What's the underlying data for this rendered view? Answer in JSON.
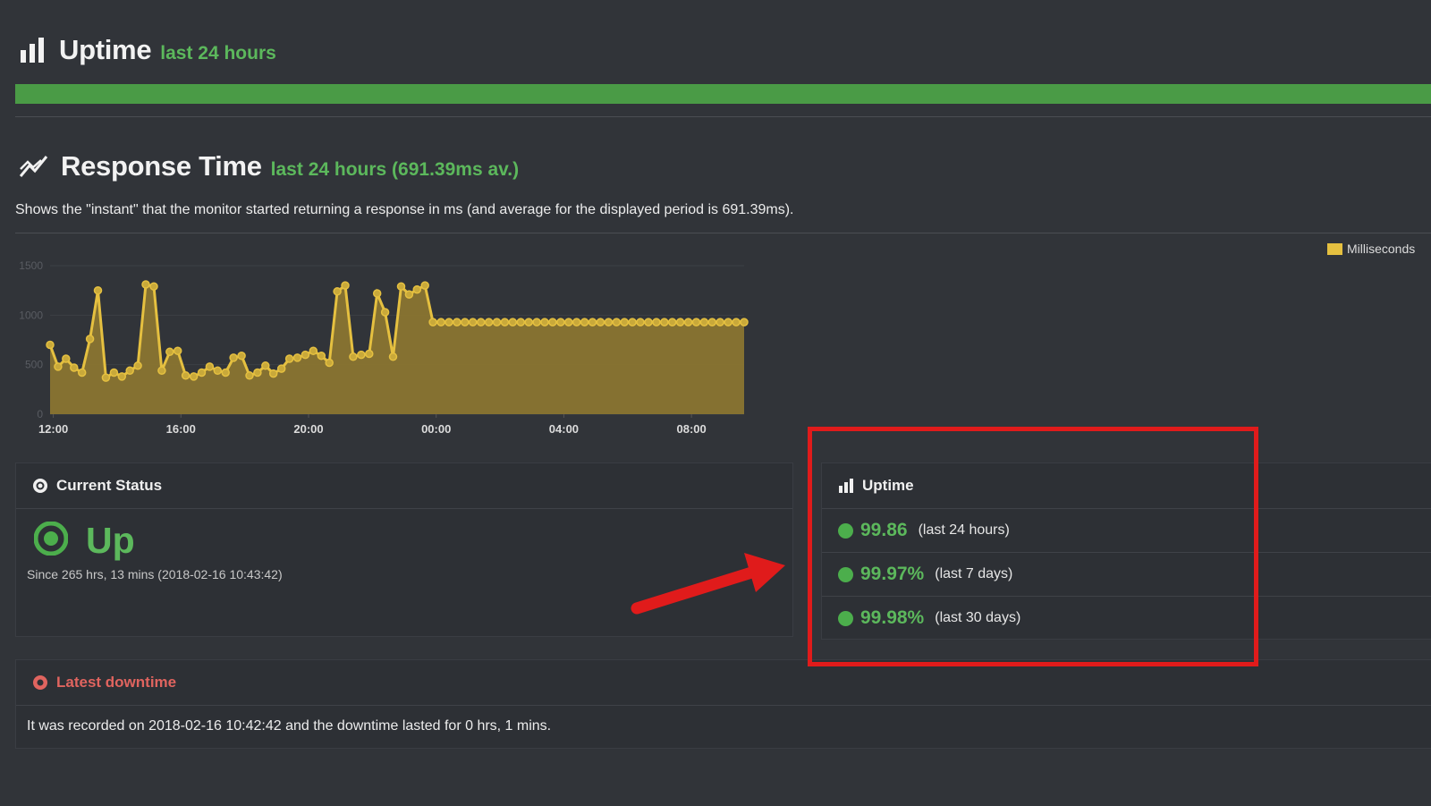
{
  "uptime_section": {
    "title": "Uptime",
    "subtitle": "last 24 hours",
    "bar_percent": 100,
    "icon": "bar-chart-icon"
  },
  "response_section": {
    "title": "Response Time",
    "subtitle": "last 24 hours (691.39ms av.)",
    "description": "Shows the \"instant\" that the monitor started returning a response in ms (and average for the displayed period is 691.39ms).",
    "icon": "line-chart-icon"
  },
  "chart_data": {
    "type": "area",
    "series": [
      {
        "name": "Milliseconds",
        "color": "#e5c040",
        "x": [
          11.9,
          12.15,
          12.4,
          12.65,
          12.9,
          13.15,
          13.4,
          13.65,
          13.9,
          14.15,
          14.4,
          14.65,
          14.9,
          15.15,
          15.4,
          15.65,
          15.9,
          16.15,
          16.4,
          16.65,
          16.9,
          17.15,
          17.4,
          17.65,
          17.9,
          18.15,
          18.4,
          18.65,
          18.9,
          19.15,
          19.4,
          19.65,
          19.9,
          20.15,
          20.4,
          20.65,
          20.9,
          21.15,
          21.4,
          21.65,
          21.9,
          22.15,
          22.4,
          22.65,
          22.9,
          23.15,
          23.4,
          23.65,
          23.9,
          24.15,
          24.4,
          24.65,
          24.9,
          25.15,
          25.4,
          25.65,
          25.9,
          26.15,
          26.4,
          26.65,
          26.9,
          27.15,
          27.4,
          27.65,
          27.9,
          28.15,
          28.4,
          28.65,
          28.9,
          29.15,
          29.4,
          29.65,
          29.9,
          30.15,
          30.4,
          30.65,
          30.9,
          31.15,
          31.4,
          31.65,
          31.9,
          32.15,
          32.4,
          32.65,
          32.9,
          33.15,
          33.4,
          33.65
        ],
        "values": [
          700,
          480,
          560,
          470,
          420,
          760,
          1250,
          370,
          420,
          380,
          440,
          490,
          1310,
          1290,
          440,
          630,
          640,
          390,
          380,
          420,
          480,
          440,
          420,
          570,
          590,
          390,
          420,
          490,
          410,
          460,
          560,
          570,
          600,
          640,
          590,
          520,
          1240,
          1300,
          580,
          600,
          610,
          1220,
          1030,
          580,
          1290,
          1210,
          1260,
          1300,
          930,
          930,
          930,
          930,
          930,
          930,
          930,
          930,
          930,
          930,
          930,
          930,
          930,
          930,
          930,
          930,
          930,
          930,
          930,
          930,
          930,
          930,
          930,
          930,
          930,
          930,
          930,
          930,
          930,
          930,
          930,
          930,
          930,
          930,
          930,
          930,
          930,
          930,
          930,
          930
        ]
      }
    ],
    "x_ticks": [
      "12:00",
      "16:00",
      "20:00",
      "00:00",
      "04:00",
      "08:00"
    ],
    "y_ticks": [
      "0",
      "500",
      "1000",
      "1500"
    ],
    "ylim": [
      0,
      1500
    ],
    "legend": "top-right"
  },
  "current_status": {
    "heading": "Current Status",
    "state": "Up",
    "since": "Since 265 hrs, 13 mins (2018-02-16 10:43:42)"
  },
  "uptime_panel": {
    "heading": "Uptime",
    "rows": [
      {
        "value": "99.86",
        "period": "(last 24 hours)"
      },
      {
        "value": "99.97%",
        "period": "(last 7 days)"
      },
      {
        "value": "99.98%",
        "period": "(last 30 days)"
      }
    ]
  },
  "latest_downtime": {
    "heading": "Latest downtime",
    "text": "It was recorded on 2018-02-16 10:42:42 and the downtime lasted for 0 hrs, 1 mins."
  },
  "colors": {
    "accent_green": "#5cb85c",
    "chart_line": "#e5c040",
    "alert_red": "#e01b1b",
    "downtime_red": "#e0645f"
  }
}
